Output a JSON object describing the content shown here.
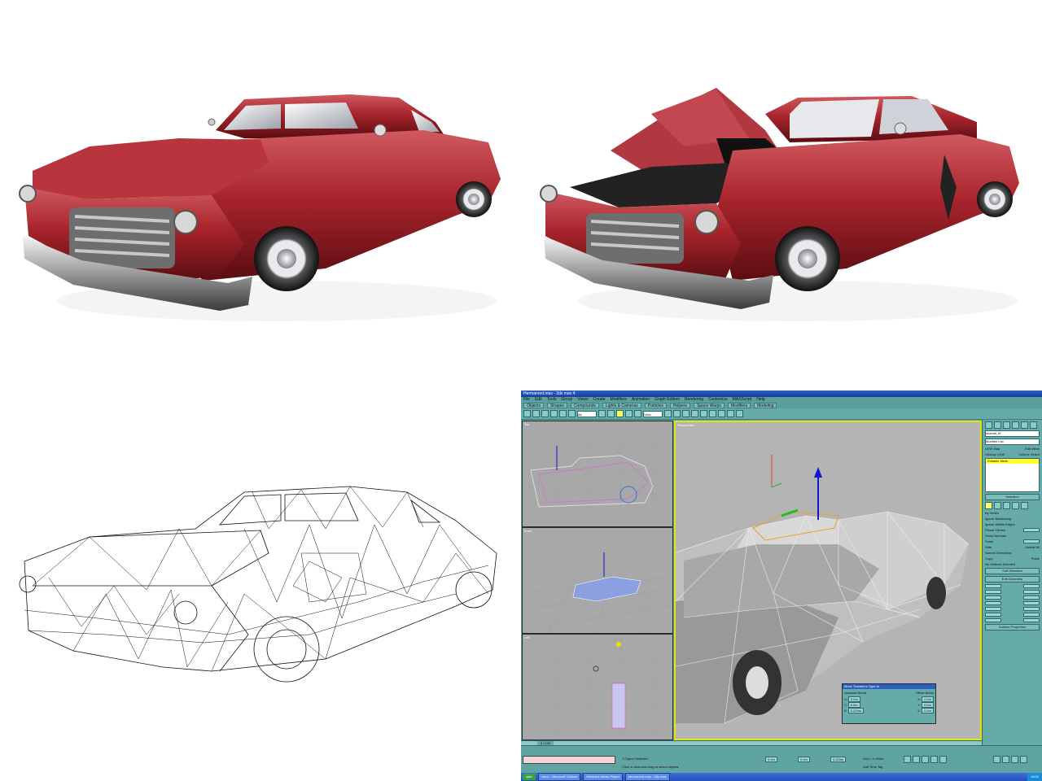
{
  "app": {
    "title": "Hermanred.max - 3ds max 4",
    "menus": [
      "File",
      "Edit",
      "Tools",
      "Group",
      "Views",
      "Create",
      "Modifiers",
      "Animation",
      "Graph Editors",
      "Rendering",
      "Customize",
      "MAXScript",
      "Help"
    ],
    "tabs": [
      "Objects",
      "Shapes",
      "Compounds",
      "Lights & Cameras",
      "Particles",
      "Helpers",
      "Space Warps",
      "Modifiers",
      "Modeling",
      "Rendering",
      "Render"
    ],
    "toolbar_select": "All",
    "toolbar_view": "View",
    "viewports": [
      "Top",
      "Front",
      "Left",
      "Perspective"
    ],
    "command_panel": {
      "object_name": "shamal_hi",
      "modifier_list": "Modifier List",
      "buttons": [
        "UVW Map",
        "Edit Mesh",
        "Unwrap UVW",
        "Volume Select"
      ],
      "stack_selected": "Editable Mesh",
      "rollouts": [
        "Selection",
        "Soft Selection",
        "Edit Geometry",
        "Surface Properties"
      ],
      "checkbox_labels": [
        "By Vertex",
        "Ignore Backfacing",
        "Ignore Visible Edges",
        "Planar Thresh",
        "Show Normals",
        "Scale",
        "Hide",
        "Unhide All",
        "Named Selections",
        "Copy",
        "Paste"
      ],
      "status": "No Vertices Selected"
    },
    "transform_dialog": {
      "title": "Move Transform Type-In",
      "absolute": "Absolute:World",
      "offset": "Offset:World",
      "axes": [
        "X:",
        "Y:",
        "Z:"
      ],
      "abs_values": [
        "0.0m",
        "0.0m",
        "0.229m"
      ],
      "off_values": [
        "0.0m",
        "0.0m",
        "0.0m"
      ]
    },
    "status": {
      "frame": "0 / 100",
      "selected": "1 Object Selected",
      "prompt": "Click or click-and-drag to select objects",
      "x": "0.0m",
      "y": "0.0m",
      "z": "0.229m",
      "grid": "Grid = 0.254m",
      "add_time_tag": "Add Time Tag"
    },
    "taskbar": {
      "start": "start",
      "items": [
        "Inbox - Microsoft Outlook",
        "Windows Media Player",
        "hermanred.max - 3ds max"
      ],
      "clock": "16:02"
    }
  },
  "colors": {
    "car_body": "#a8242c",
    "ui_background": "#5fa3a3",
    "viewport_active_border": "#e6e600",
    "titlebar": "#2a5fc4"
  }
}
